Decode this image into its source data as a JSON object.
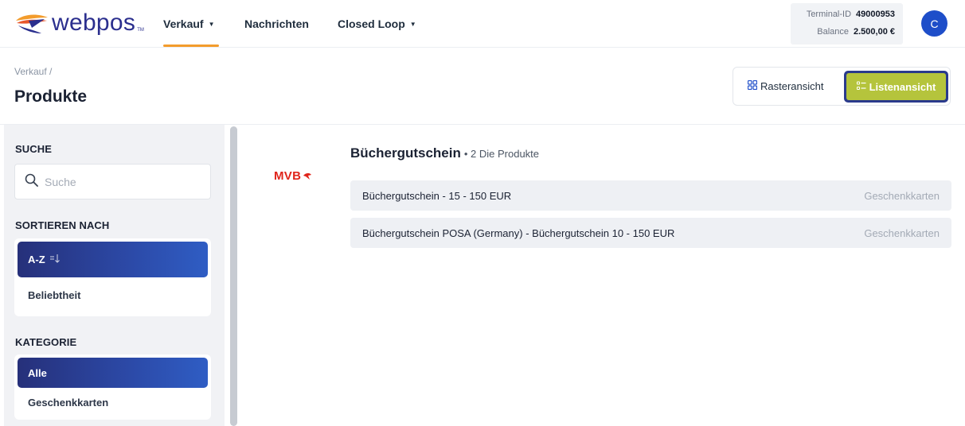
{
  "brand": {
    "name": "webpos",
    "tm": "TM"
  },
  "nav": {
    "items": [
      {
        "label": "Verkauf",
        "has_caret": true,
        "active": true
      },
      {
        "label": "Nachrichten",
        "has_caret": false,
        "active": false
      },
      {
        "label": "Closed Loop",
        "has_caret": true,
        "active": false
      }
    ],
    "caret_glyph": "▼"
  },
  "terminal": {
    "id_label": "Terminal-ID",
    "id_value": "49000953",
    "balance_label": "Balance",
    "balance_value": "2.500,00 €"
  },
  "user": {
    "initial": "C"
  },
  "page": {
    "breadcrumb": "Verkauf /",
    "title": "Produkte"
  },
  "view_toggle": {
    "grid_label": "Rasteransicht",
    "list_label": "Listenansicht",
    "active": "list"
  },
  "sidebar": {
    "search_title": "SUCHE",
    "search_placeholder": "Suche",
    "sort_title": "SORTIEREN NACH",
    "sort_options": [
      {
        "label": "A-Z",
        "active": true
      },
      {
        "label": "Beliebtheit",
        "active": false
      }
    ],
    "category_title": "KATEGORIE",
    "category_options": [
      {
        "label": "Alle",
        "active": true
      },
      {
        "label": "Geschenkkarten",
        "active": false
      }
    ]
  },
  "content": {
    "brand_logo_text": "MVB",
    "group_title": "Büchergutschein",
    "group_count": "• 2 Die Produkte",
    "products": [
      {
        "name": "Büchergutschein - 15 - 150 EUR",
        "category": "Geschenkkarten"
      },
      {
        "name": "Büchergutschein POSA (Germany) - Büchergutschein 10 - 150 EUR",
        "category": "Geschenkkarten"
      }
    ]
  },
  "colors": {
    "brand_blue": "#2b2f8e",
    "accent_orange": "#f39c2c",
    "avatar_blue": "#1e4ec9",
    "active_gradient_start": "#26307a",
    "active_gradient_end": "#2f5dc4",
    "highlight_yellow": "#b5c43c",
    "mvb_red": "#e0251b"
  }
}
